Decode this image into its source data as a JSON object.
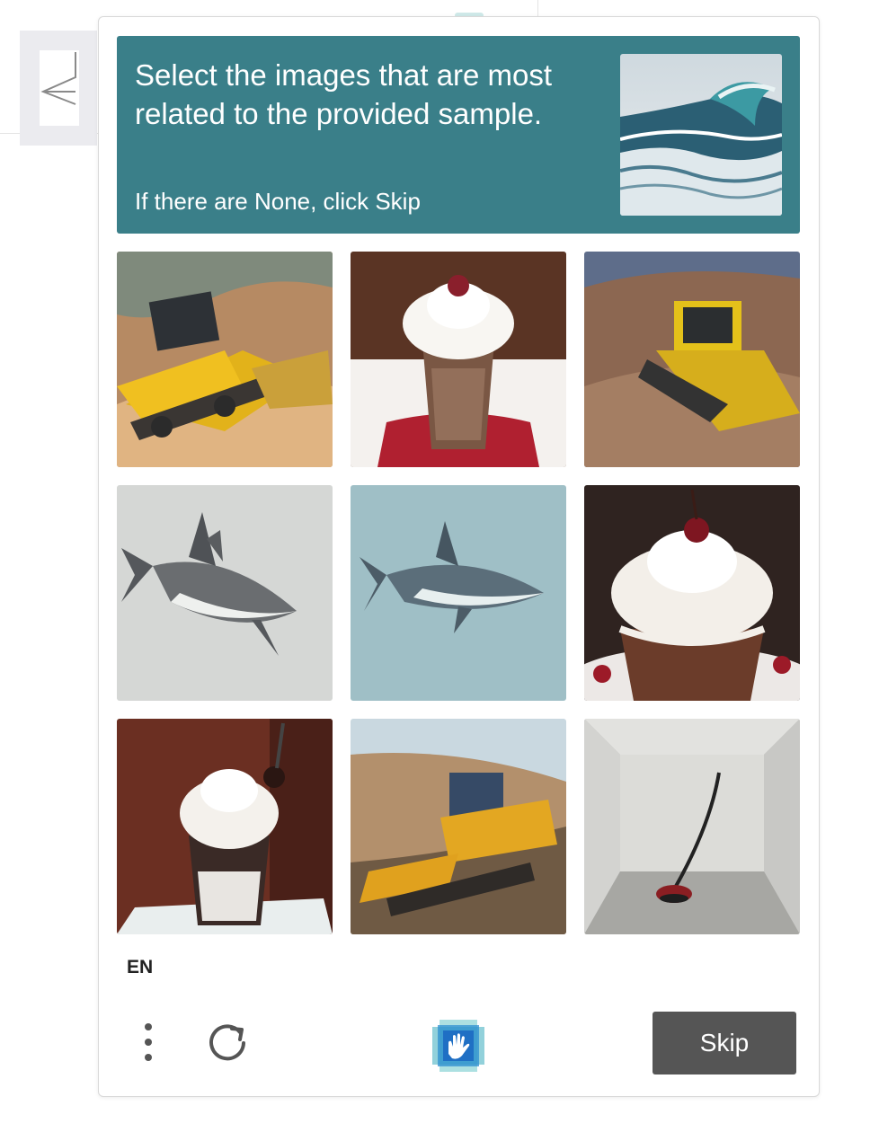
{
  "prompt": {
    "title": "Select the images that are most related to the provided sample.",
    "subtitle": "If there are None, click Skip",
    "sample_image": "ocean wave"
  },
  "grid": {
    "tiles": [
      {
        "label": "bulldozer on sand slope",
        "icon": "bulldozer"
      },
      {
        "label": "milkshake with whipped cream and cherry",
        "icon": "milkshake"
      },
      {
        "label": "bulldozer on dirt hill",
        "icon": "bulldozer"
      },
      {
        "label": "shark on gray background",
        "icon": "shark"
      },
      {
        "label": "shark on blue background",
        "icon": "shark"
      },
      {
        "label": "chocolate milkshake with cherry",
        "icon": "milkshake"
      },
      {
        "label": "iced drink with whipped cream",
        "icon": "milkshake"
      },
      {
        "label": "bulldozer on slope",
        "icon": "bulldozer"
      },
      {
        "label": "vacuum cleaner in empty room",
        "icon": "vacuum"
      }
    ]
  },
  "footer": {
    "language": "EN",
    "skip_label": "Skip",
    "menu_icon": "vertical-dots-icon",
    "refresh_icon": "refresh-icon",
    "logo_icon": "hcaptcha-logo-icon"
  },
  "colors": {
    "prompt_bg": "#3a7f89",
    "skip_bg": "#555555"
  }
}
